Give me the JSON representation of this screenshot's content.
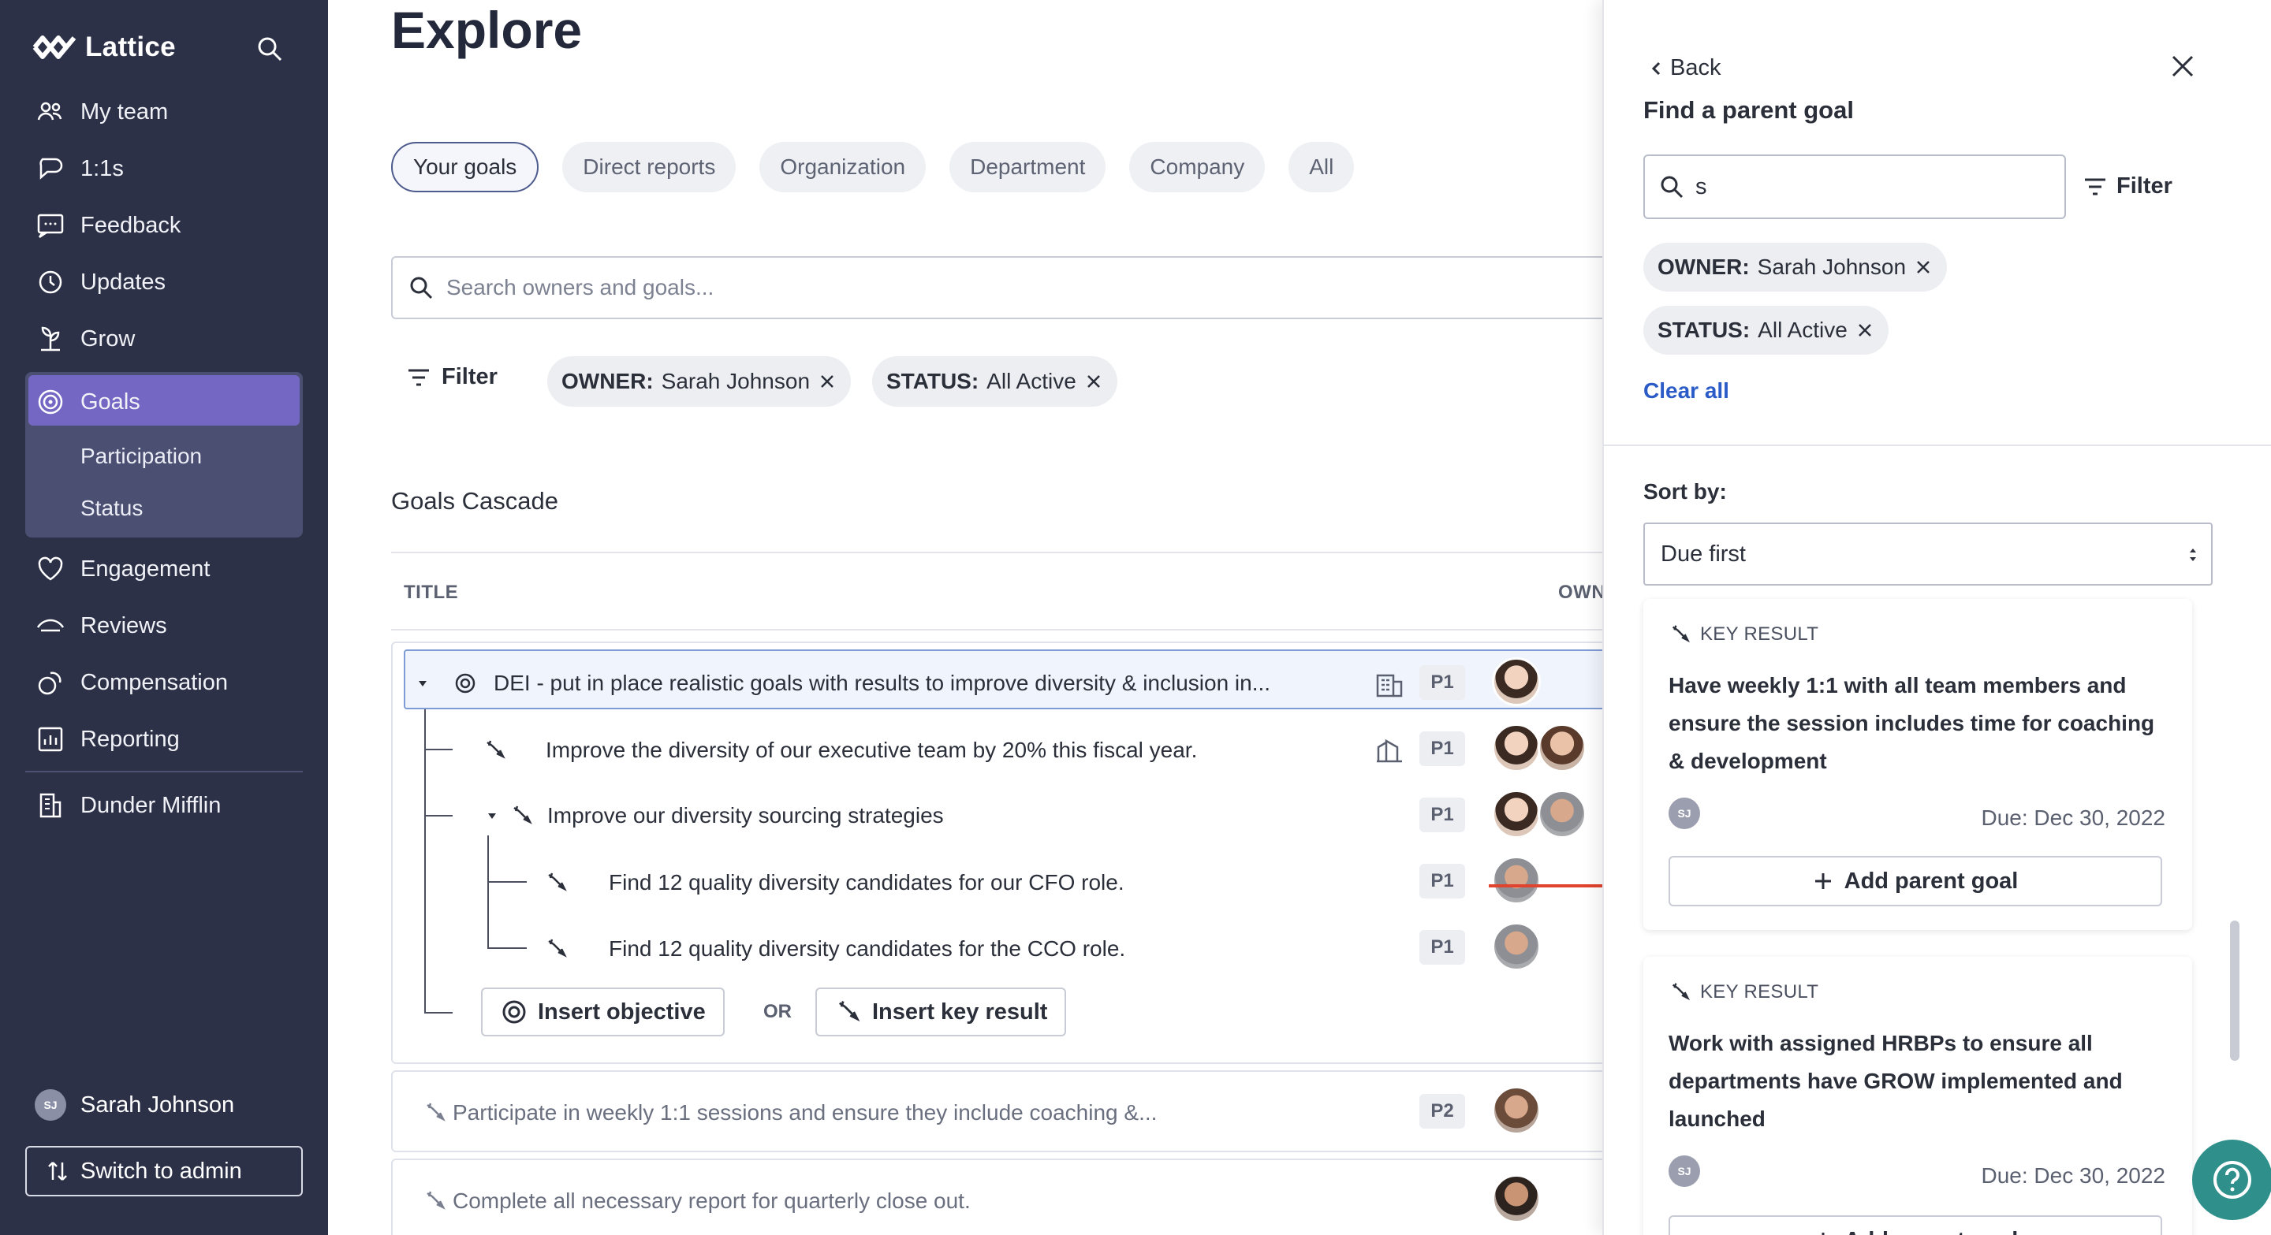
{
  "app": {
    "brand": "Lattice"
  },
  "sidebar": {
    "items": [
      {
        "label": "My team",
        "icon": "team-icon"
      },
      {
        "label": "1:1s",
        "icon": "chat-icon"
      },
      {
        "label": "Feedback",
        "icon": "feedback-icon"
      },
      {
        "label": "Updates",
        "icon": "updates-icon"
      },
      {
        "label": "Grow",
        "icon": "grow-icon"
      },
      {
        "label": "Goals",
        "icon": "goals-icon"
      },
      {
        "label": "Engagement",
        "icon": "heart-icon"
      },
      {
        "label": "Reviews",
        "icon": "reviews-icon"
      },
      {
        "label": "Compensation",
        "icon": "compensation-icon"
      },
      {
        "label": "Reporting",
        "icon": "reporting-icon"
      },
      {
        "label": "Dunder Mifflin",
        "icon": "building-icon"
      }
    ],
    "goals_sub": [
      "Participation",
      "Status"
    ],
    "user": {
      "name": "Sarah Johnson",
      "initials": "SJ"
    },
    "switch_label": "Switch to admin"
  },
  "main": {
    "title": "Explore",
    "tabs": [
      "Your goals",
      "Direct reports",
      "Organization",
      "Department",
      "Company",
      "All"
    ],
    "search_placeholder": "Search owners and goals...",
    "filter_label": "Filter",
    "chips": [
      {
        "key": "OWNER:",
        "value": "Sarah Johnson"
      },
      {
        "key": "STATUS:",
        "value": "All Active"
      }
    ],
    "section_title": "Goals Cascade",
    "columns": {
      "title": "TITLE",
      "owners": "OWNERS"
    },
    "rows": [
      {
        "text": "DEI - put in place realistic goals with results to improve diversity & inclusion in...",
        "priority": "P1"
      },
      {
        "text": "Improve the diversity of our executive team by 20% this fiscal year.",
        "priority": "P1"
      },
      {
        "text": "Improve our diversity sourcing strategies",
        "priority": "P1"
      },
      {
        "text": "Find 12 quality diversity candidates for our CFO role.",
        "priority": "P1"
      },
      {
        "text": "Find 12 quality diversity candidates for the CCO role.",
        "priority": "P1"
      }
    ],
    "insert_objective": "Insert objective",
    "or_label": "OR",
    "insert_kr": "Insert key result",
    "other_rows": [
      {
        "text": "Participate in weekly 1:1 sessions and ensure they include coaching &...",
        "priority": "P2"
      },
      {
        "text": "Complete all necessary report for quarterly close out."
      }
    ]
  },
  "panel": {
    "back_label": "Back",
    "title": "Find a parent goal",
    "search_value": "s",
    "filter_label": "Filter",
    "chips": [
      {
        "key": "OWNER:",
        "value": "Sarah Johnson"
      },
      {
        "key": "STATUS:",
        "value": "All Active"
      }
    ],
    "clear_all": "Clear all",
    "sort_label": "Sort by:",
    "sort_value": "Due first",
    "results": [
      {
        "type": "KEY RESULT",
        "title": "Have weekly 1:1 with all team members and ensure the session includes time for coaching & development",
        "owner_initials": "SJ",
        "due": "Due: Dec 30, 2022",
        "action": "Add parent goal"
      },
      {
        "type": "KEY RESULT",
        "title": "Work with assigned HRBPs to ensure all departments have GROW implemented and launched",
        "owner_initials": "SJ",
        "due": "Due: Dec 30, 2022",
        "action": "Add parent goal"
      }
    ]
  },
  "colors": {
    "sidebar_bg": "#2d3147",
    "goals_active": "#7467c3",
    "link_blue": "#2a5bc7",
    "help_teal": "#2f8f8b",
    "annotation_red": "#e0432e"
  }
}
